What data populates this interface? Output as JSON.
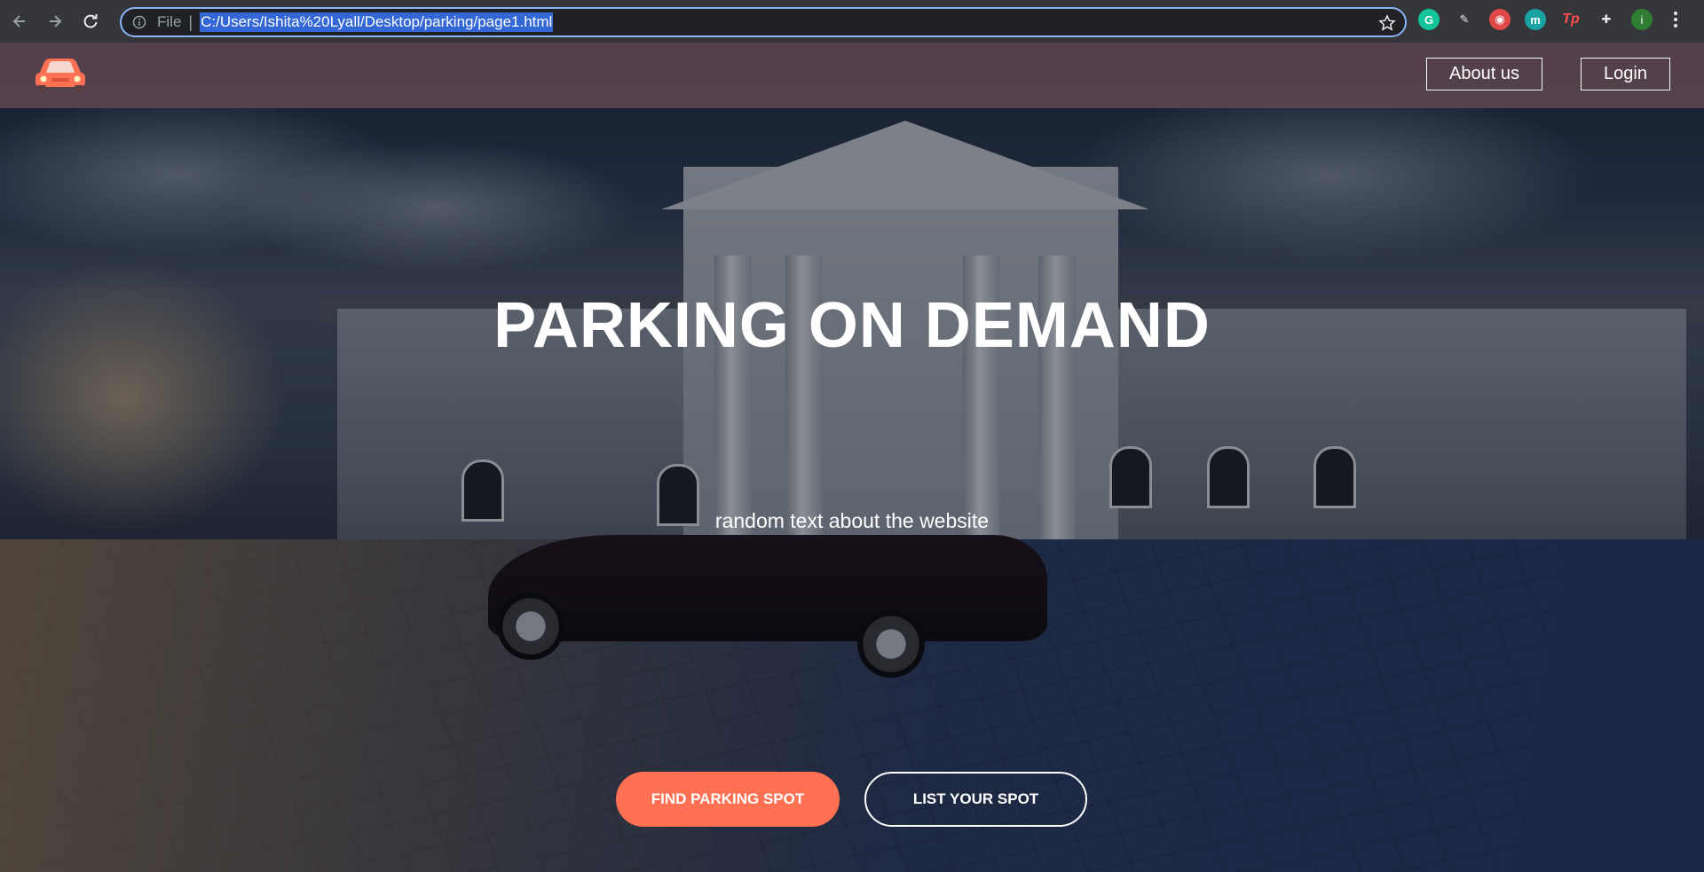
{
  "browser": {
    "scheme_label": "File",
    "url": "C:/Users/Ishita%20Lyall/Desktop/parking/page1.html",
    "extensions": [
      {
        "icon": "grammarly-icon",
        "text": "G"
      },
      {
        "icon": "pen-icon",
        "text": "✎"
      },
      {
        "icon": "eyes-icon",
        "text": "◉"
      },
      {
        "icon": "m-extension-icon",
        "text": "m"
      },
      {
        "icon": "tp-extension-icon",
        "text": "Tp"
      },
      {
        "icon": "puzzle-icon",
        "text": "✚"
      }
    ],
    "profile_initial": "i"
  },
  "site": {
    "logo_icon": "car-logo-icon",
    "accent_color": "#ff7152",
    "nav": {
      "about_label": "About us",
      "login_label": "Login"
    },
    "hero": {
      "title": "PARKING ON DEMAND",
      "subtitle": "random text about the website"
    },
    "buttons": {
      "find_label": "FIND PARKING SPOT",
      "list_label": "LIST YOUR SPOT"
    }
  }
}
